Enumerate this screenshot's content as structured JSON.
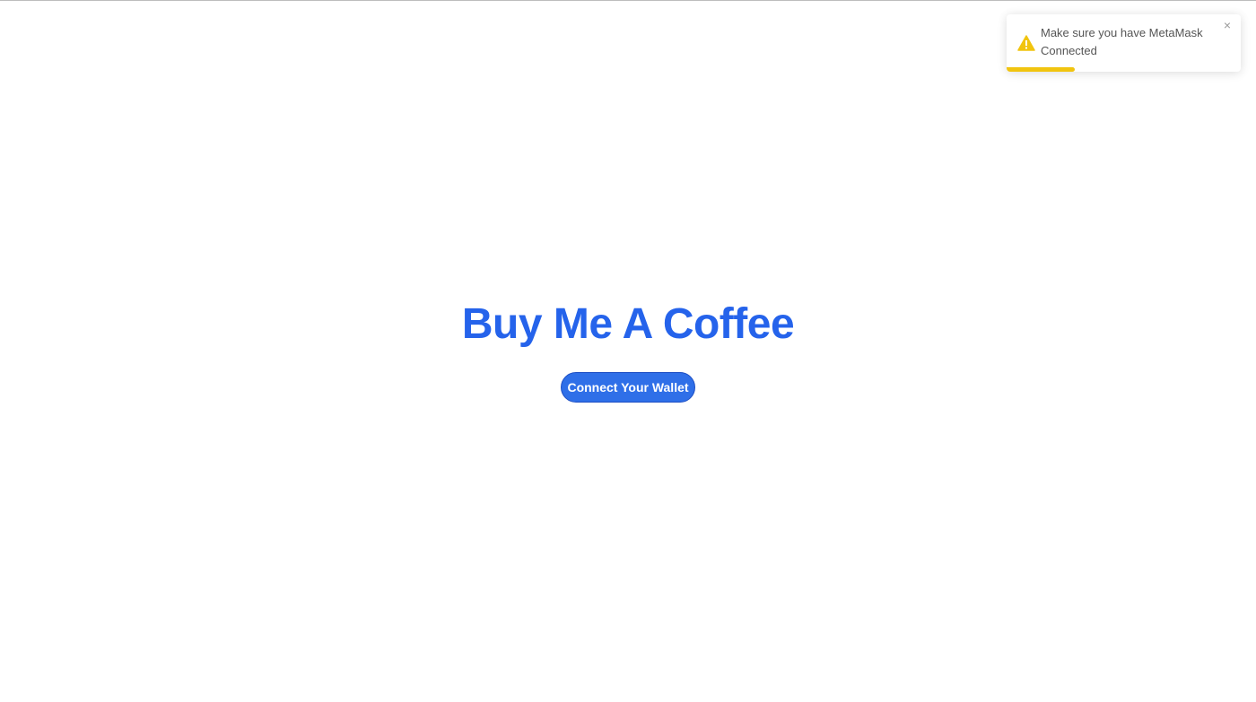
{
  "page": {
    "title": "Buy Me A Coffee",
    "connect_button_label": "Connect Your Wallet"
  },
  "toast": {
    "message": "Make sure you have MetaMask Connected",
    "close_symbol": "×",
    "icon": "warning-icon",
    "type": "warning",
    "progress": 0.29
  },
  "colors": {
    "accent": "#2563eb",
    "button": "#2f6fe8",
    "warning": "#f1c40f"
  }
}
